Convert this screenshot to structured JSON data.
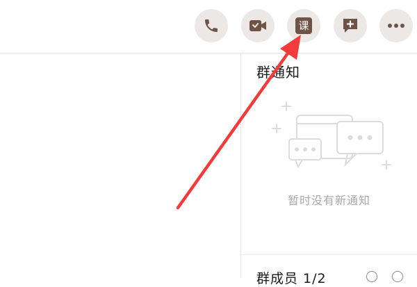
{
  "toolbar": {
    "buttons": [
      {
        "icon": "phone-icon"
      },
      {
        "icon": "video-icon"
      },
      {
        "icon": "course-icon",
        "glyph": "课"
      },
      {
        "icon": "add-message-icon"
      },
      {
        "icon": "more-icon"
      }
    ]
  },
  "group_notice": {
    "title": "群通知",
    "empty_text": "暂时没有新通知"
  },
  "members": {
    "label": "群成员 1/2"
  },
  "colors": {
    "icon_brown": "#6e5346",
    "button_bg": "#ece8e5",
    "annotation_red": "#f23c3c"
  }
}
